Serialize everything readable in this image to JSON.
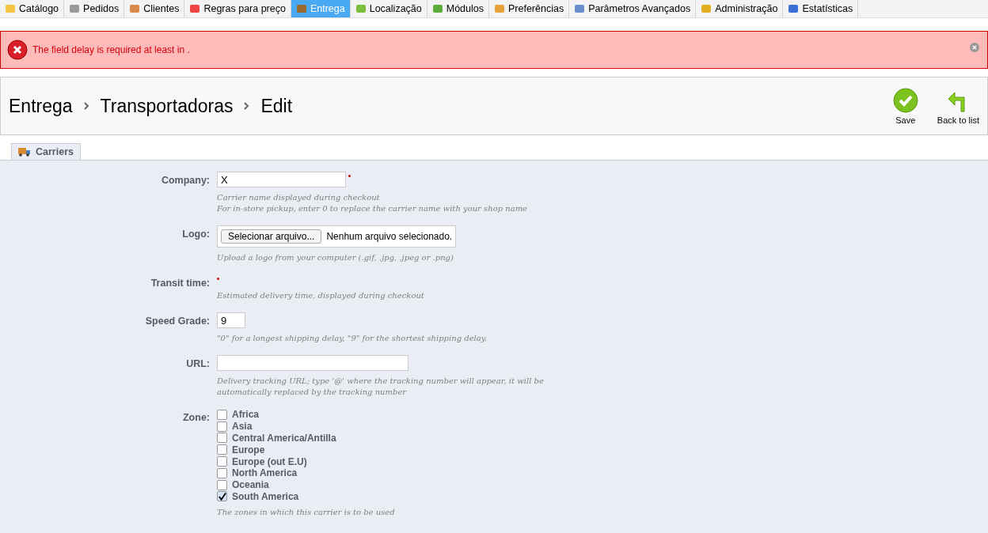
{
  "tabs": [
    {
      "label": "Catálogo",
      "selected": false
    },
    {
      "label": "Pedidos",
      "selected": false
    },
    {
      "label": "Clientes",
      "selected": false
    },
    {
      "label": "Regras para preço",
      "selected": false
    },
    {
      "label": "Entrega",
      "selected": true
    },
    {
      "label": "Localização",
      "selected": false
    },
    {
      "label": "Módulos",
      "selected": false
    },
    {
      "label": "Preferências",
      "selected": false
    },
    {
      "label": "Parâmetros Avançados",
      "selected": false
    },
    {
      "label": "Administração",
      "selected": false
    },
    {
      "label": "Estatísticas",
      "selected": false
    }
  ],
  "error": {
    "message": "The field delay is required at least in ."
  },
  "breadcrumb": [
    "Entrega",
    "Transportadoras",
    "Edit"
  ],
  "toolbar": [
    {
      "label": "Save",
      "kind": "save"
    },
    {
      "label": "Back to list",
      "kind": "back"
    }
  ],
  "fieldset": {
    "legend": "Carriers",
    "fields": [
      {
        "kind": "text",
        "label": "Company:",
        "value": "X",
        "required": true,
        "help": [
          "Carrier name displayed during checkout",
          "For in-store pickup, enter 0 to replace the carrier name with your shop name"
        ]
      },
      {
        "kind": "file",
        "label": "Logo:",
        "button": "Selecionar arquivo...",
        "status": "Nenhum arquivo selecionado.",
        "required": false,
        "help": [
          "Upload a logo from your computer (.gif, .jpg, .jpeg or .png)"
        ]
      },
      {
        "kind": "empty",
        "label": "Transit time:",
        "required": true,
        "help": [
          "Estimated delivery time, displayed during checkout"
        ]
      },
      {
        "kind": "text",
        "label": "Speed Grade:",
        "value": "9",
        "required": false,
        "help": [
          "\"0\" for a longest shipping delay, \"9\" for the shortest shipping delay."
        ]
      },
      {
        "kind": "text",
        "label": "URL:",
        "required": false,
        "help": [
          "Delivery tracking URL; type '@' where the tracking number will appear, it will be automatically replaced by the tracking number"
        ]
      },
      {
        "kind": "zones",
        "label": "Zone:",
        "required": false,
        "zones": [
          {
            "label": "Africa",
            "checked": false
          },
          {
            "label": "Asia",
            "checked": false
          },
          {
            "label": "Central America/Antilla",
            "checked": false
          },
          {
            "label": "Europe",
            "checked": false
          },
          {
            "label": "Europe (out E.U)",
            "checked": false
          },
          {
            "label": "North America",
            "checked": false
          },
          {
            "label": "Oceania",
            "checked": false
          },
          {
            "label": "South America",
            "checked": true
          }
        ],
        "help": [
          "The zones in which this carrier is to be used"
        ]
      }
    ]
  }
}
